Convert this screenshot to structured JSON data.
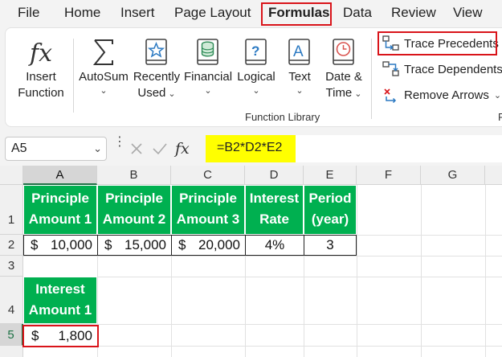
{
  "menu": {
    "items": [
      {
        "label": "File"
      },
      {
        "label": "Home"
      },
      {
        "label": "Insert"
      },
      {
        "label": "Page Layout"
      },
      {
        "label": "Formulas"
      },
      {
        "label": "Data"
      },
      {
        "label": "Review"
      },
      {
        "label": "View"
      }
    ],
    "active": "Formulas"
  },
  "ribbon": {
    "insert_function": {
      "line1": "Insert",
      "line2": "Function",
      "icon": "fx-icon"
    },
    "autosum": {
      "label": "AutoSum",
      "icon": "sigma-icon"
    },
    "recently_used": {
      "line1": "Recently",
      "line2": "Used",
      "icon": "star-book-icon"
    },
    "financial": {
      "label": "Financial",
      "icon": "coins-book-icon"
    },
    "logical": {
      "label": "Logical",
      "icon": "question-book-icon"
    },
    "text": {
      "label": "Text",
      "icon": "letter-a-book-icon"
    },
    "date_time": {
      "line1": "Date &",
      "line2": "Time",
      "icon": "clock-book-icon"
    },
    "group_label": "Function Library",
    "trace_precedents": "Trace Precedents",
    "trace_dependents": "Trace Dependents",
    "remove_arrows": "Remove Arrows",
    "cut_group_letter": "F"
  },
  "formula_bar": {
    "name_box": "A5",
    "fx": "fx",
    "formula": "=B2*D2*E2"
  },
  "sheet": {
    "columns": [
      "A",
      "B",
      "C",
      "D",
      "E",
      "F",
      "G"
    ],
    "rows": [
      "1",
      "2",
      "3",
      "4",
      "5"
    ],
    "headers": {
      "a1": {
        "l1": "Principle",
        "l2": "Amount 1"
      },
      "b1": {
        "l1": "Principle",
        "l2": "Amount 2"
      },
      "c1": {
        "l1": "Principle",
        "l2": "Amount 3"
      },
      "d1": {
        "l1": "Interest",
        "l2": "Rate"
      },
      "e1": {
        "l1": "Period",
        "l2": "(year)"
      },
      "a4": {
        "l1": "Interest",
        "l2": "Amount 1"
      }
    },
    "row2": {
      "a": {
        "currency": "$",
        "amount": "10,000"
      },
      "b": {
        "currency": "$",
        "amount": "15,000"
      },
      "c": {
        "currency": "$",
        "amount": "20,000"
      },
      "d": "4%",
      "e": "3"
    },
    "a5": {
      "currency": "$",
      "amount": "1,800"
    }
  },
  "colors": {
    "header_green": "#00b050",
    "highlight_red": "#d9141a",
    "formula_yellow": "#ffff00",
    "selection_green": "#1e7145"
  }
}
